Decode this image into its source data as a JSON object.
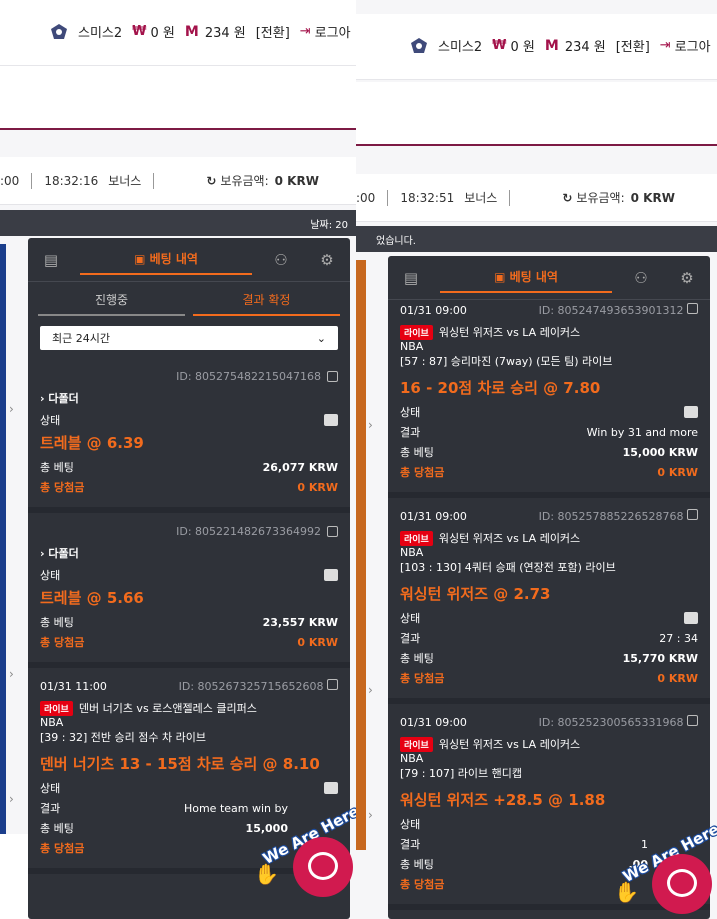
{
  "left": {
    "header": {
      "user": "스미스2",
      "won_symbol": "₩",
      "won": "0 원",
      "m_symbol": "M",
      "mileage": "234 원",
      "convert": "[전환]",
      "logout": "로그아"
    },
    "infobar": {
      "time_prefix": ":00",
      "clock": "18:32:16",
      "bonus": "보너스",
      "balance_label": "보유금액:",
      "balance": "0 KRW"
    },
    "notice": "날짜: 20",
    "panel": {
      "tab_bet_history": "베팅 내역",
      "subtab_pending": "진행중",
      "subtab_settled": "결과 확정",
      "filter": "최근 24시간",
      "cards": [
        {
          "id": "ID: 805275482215047168",
          "folder": "다폴더",
          "status_label": "상태",
          "pick": "트레블 @ 6.39",
          "bet_label": "총 베팅",
          "bet": "26,077 KRW",
          "win_label": "총 당첨금",
          "win": "0 KRW"
        },
        {
          "id": "ID: 805221482673364992",
          "folder": "다폴더",
          "status_label": "상태",
          "pick": "트레블 @ 5.66",
          "bet_label": "총 베팅",
          "bet": "23,557 KRW",
          "win_label": "총 당첨금",
          "win": "0 KRW"
        },
        {
          "date": "01/31 11:00",
          "id": "ID: 805267325715652608",
          "live": "라이브",
          "match": "덴버 너기츠 vs 로스앤젤레스 클리퍼스",
          "league": "NBA",
          "market": "[39 : 32] 전반 승리 점수 차 라이브",
          "pick": "덴버 너기츠 13 - 15점 차로 승리 @ 8.10",
          "status_label": "상태",
          "result_label": "결과",
          "result": "Home team win by",
          "bet_label": "총 베팅",
          "bet": "15,000",
          "win_label": "총 당첨금"
        }
      ]
    }
  },
  "right": {
    "header": {
      "user": "스미스2",
      "won_symbol": "₩",
      "won": "0 원",
      "m_symbol": "M",
      "mileage": "234 원",
      "convert": "[전환]",
      "logout": "로그아"
    },
    "infobar": {
      "time_prefix": ":00",
      "clock": "18:32:51",
      "bonus": "보너스",
      "balance_label": "보유금액:",
      "balance": "0 KRW"
    },
    "notice": "었습니다.",
    "panel": {
      "tab_bet_history": "베팅 내역",
      "cards": [
        {
          "date": "01/31 09:00",
          "id": "ID: 805247493653901312",
          "live": "라이브",
          "match": "워싱턴 위저즈 vs LA 레이커스",
          "league": "NBA",
          "market": "[57 : 87] 승리마진 (7way) (모든 팀) 라이브",
          "pick": "16 - 20점 차로 승리 @ 7.80",
          "status_label": "상태",
          "result_label": "결과",
          "result": "Win by 31 and more",
          "bet_label": "총 베팅",
          "bet": "15,000 KRW",
          "win_label": "총 당첨금",
          "win": "0 KRW"
        },
        {
          "date": "01/31 09:00",
          "id": "ID: 805257885226528768",
          "live": "라이브",
          "match": "워싱턴 위저즈 vs LA 레이커스",
          "league": "NBA",
          "market": "[103 : 130] 4쿼터 승패 (연장전 포함) 라이브",
          "pick": "워싱턴 위저즈 @ 2.73",
          "status_label": "상태",
          "result_label": "결과",
          "result": "27 : 34",
          "bet_label": "총 베팅",
          "bet": "15,770 KRW",
          "win_label": "총 당첨금",
          "win": "0 KRW"
        },
        {
          "date": "01/31 09:00",
          "id": "ID: 805252300565331968",
          "live": "라이브",
          "match": "워싱턴 위저즈 vs LA 레이커스",
          "league": "NBA",
          "market": "[79 : 107] 라이브 핸디캡",
          "pick": "워싱턴 위저즈 +28.5 @ 1.88",
          "status_label": "상태",
          "result_label": "결과",
          "result": "1",
          "bet_label": "총 베팅",
          "bet": ",00",
          "win_label": "총 당첨금"
        }
      ]
    }
  },
  "widget": {
    "text": "We Are Here"
  }
}
